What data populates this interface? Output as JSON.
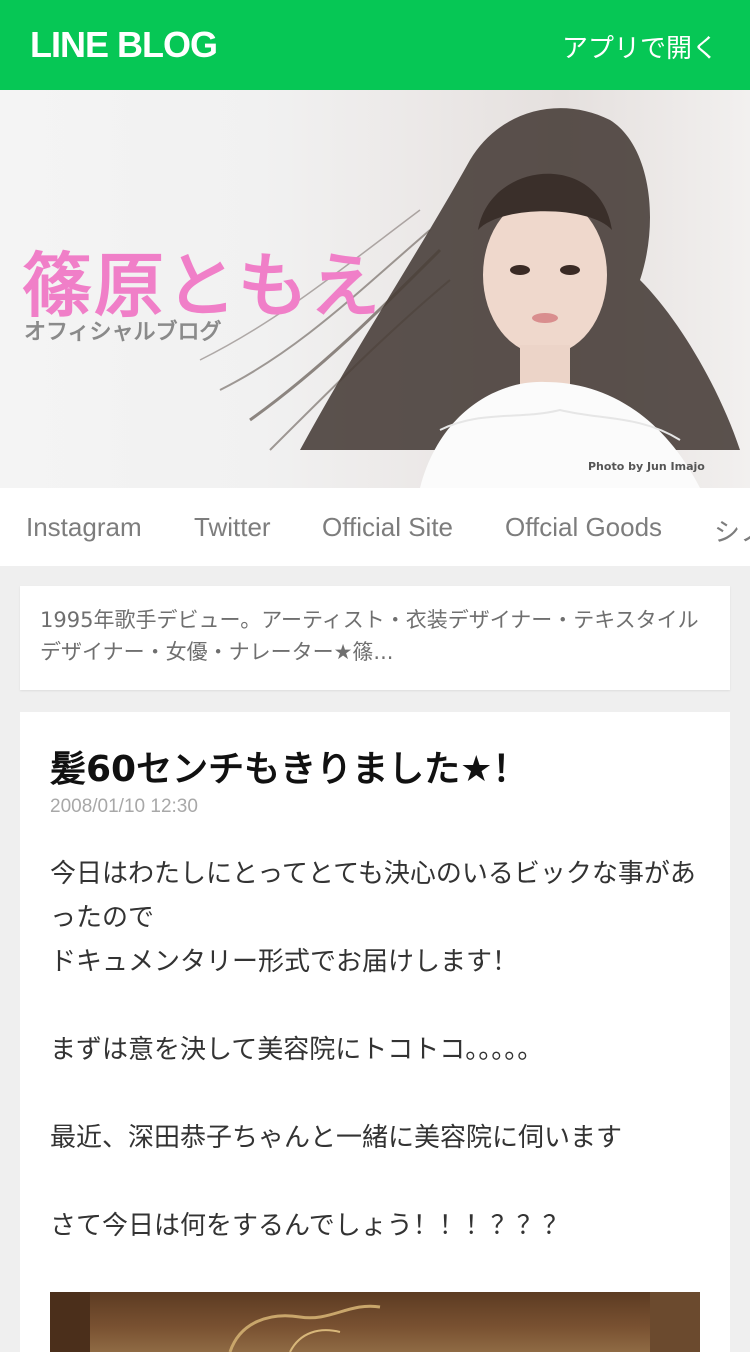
{
  "header": {
    "logo": "LINE BLOG",
    "open_app": "アプリで開く"
  },
  "hero": {
    "name": "篠原ともえ",
    "subtitle": "オフィシャルブログ",
    "credit": "Photo by Jun Imajo"
  },
  "tabs": [
    {
      "label": "Instagram"
    },
    {
      "label": "Twitter"
    },
    {
      "label": "Official Site"
    },
    {
      "label": "Offcial Goods"
    },
    {
      "label": "シノ"
    }
  ],
  "profile": {
    "text": "1995年歌手デビュー。アーティスト・衣装デザイナー・テキスタイルデザイナー・女優・ナレーター★篠..."
  },
  "post": {
    "title": "髪60センチもきりました★！",
    "date": "2008/01/10 12:30",
    "paragraphs": [
      "今日はわたしにとってとても決心のいるビックな事があったので\nドキュメンタリー形式でお届けします！",
      "まずは意を決して美容院にトコトコ。。。。。",
      "最近、深田恭子ちゃんと一緒に美容院に伺います",
      "さて今日は何をするんでしょう！！！？？？"
    ]
  },
  "colors": {
    "brand_green": "#06c755",
    "name_pink": "#f07fc8"
  }
}
